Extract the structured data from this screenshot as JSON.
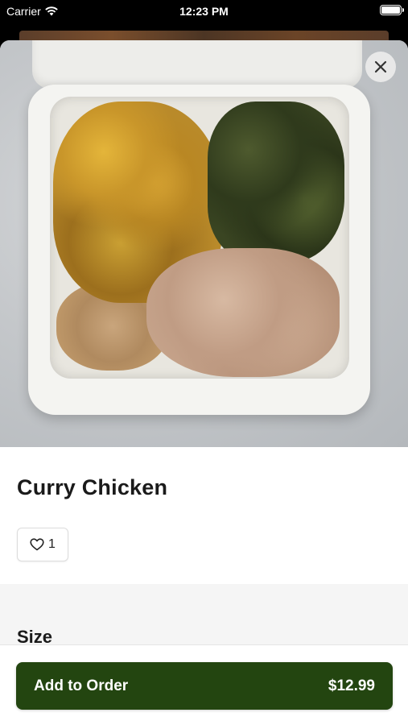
{
  "status_bar": {
    "carrier": "Carrier",
    "time": "12:23 PM"
  },
  "item": {
    "title": "Curry Chicken",
    "like_count": "1",
    "image_icon": "food-photo"
  },
  "sections": {
    "size_label": "Size"
  },
  "cta": {
    "label": "Add to Order",
    "price": "$12.99",
    "color": "#234510"
  },
  "icons": {
    "close": "close-icon",
    "heart": "heart-icon",
    "wifi": "wifi-icon",
    "battery": "battery-icon"
  }
}
